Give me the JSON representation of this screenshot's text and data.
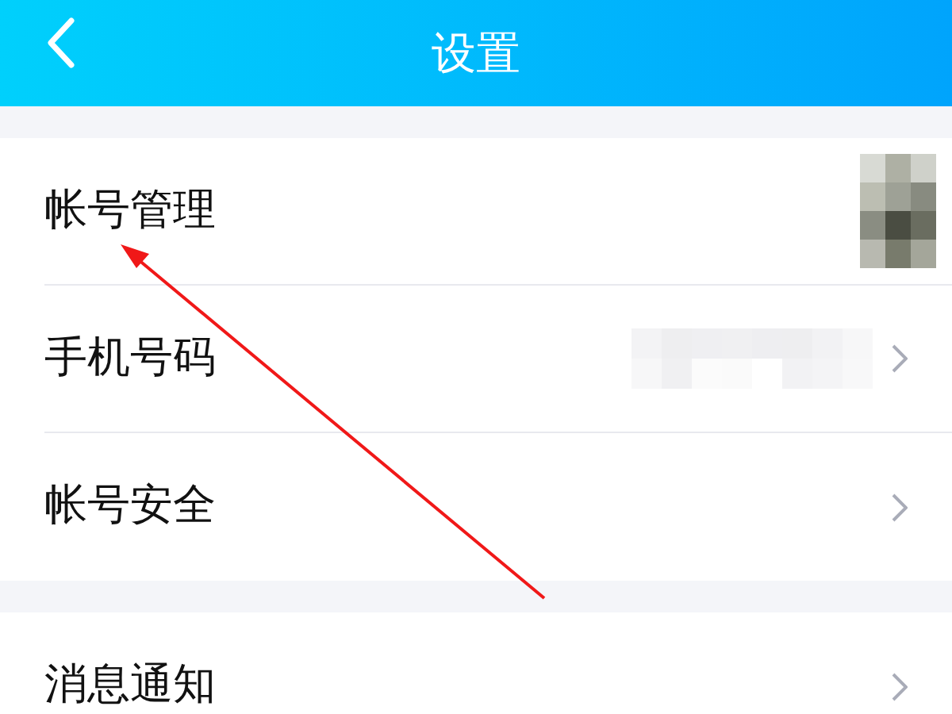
{
  "header": {
    "title": "设置"
  },
  "sections": [
    {
      "rows": [
        {
          "label": "帐号管理",
          "kind": "avatar"
        },
        {
          "label": "手机号码",
          "kind": "masked"
        },
        {
          "label": "帐号安全",
          "kind": "plain"
        }
      ]
    },
    {
      "rows": [
        {
          "label": "消息通知",
          "kind": "plain"
        }
      ]
    }
  ]
}
